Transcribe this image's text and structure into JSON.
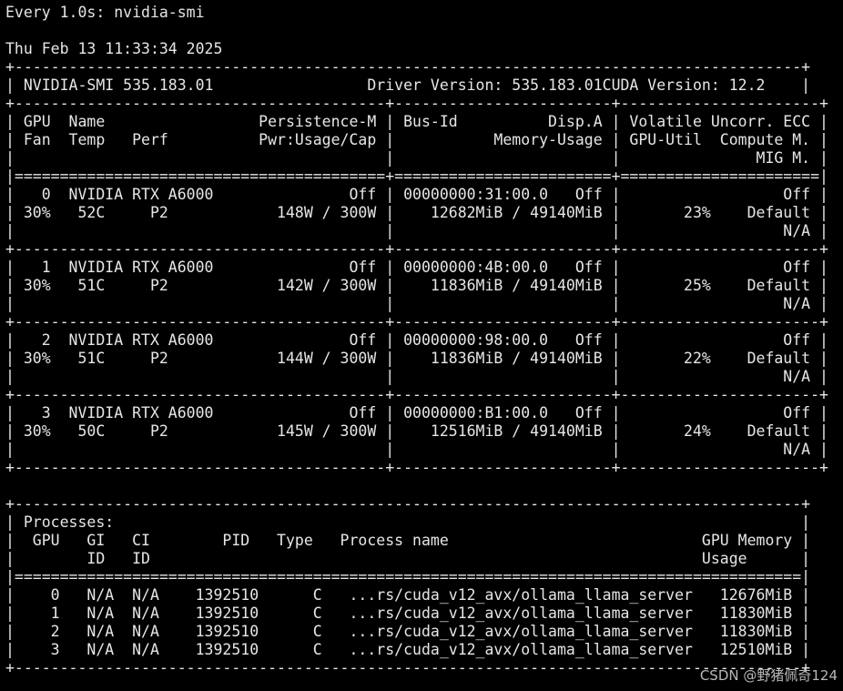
{
  "terminal": {
    "watch_header": "Every 1.0s: nvidia-smi",
    "timestamp": "Thu Feb 13 11:33:34 2025",
    "smi_version": "NVIDIA-SMI 535.183.01",
    "driver_version": "Driver Version: 535.183.01",
    "cuda_version": "CUDA Version: 12.2",
    "gpu_table": {
      "headers": {
        "col1": [
          "GPU  Name",
          "Fan  Temp   Perf",
          ""
        ],
        "col1_right": [
          "Persistence-M",
          "Pwr:Usage/Cap",
          ""
        ],
        "col2_left": [
          "Bus-Id",
          "",
          ""
        ],
        "col2_right": [
          "Disp.A",
          "Memory-Usage",
          ""
        ],
        "col3_left": [
          "Volatile",
          "GPU-Util",
          ""
        ],
        "col3_right": [
          "Uncorr. ECC",
          "Compute M.",
          "MIG M."
        ]
      },
      "gpus": [
        {
          "index": "0",
          "name": "NVIDIA RTX A6000",
          "persistence": "Off",
          "bus_id": "00000000:31:00.0",
          "disp": "Off",
          "ecc": "Off",
          "fan": "30%",
          "temp": "52C",
          "perf": "P2",
          "power": "148W / 300W",
          "memory": "12682MiB / 49140MiB",
          "util": "23%",
          "compute": "Default",
          "mig": "N/A"
        },
        {
          "index": "1",
          "name": "NVIDIA RTX A6000",
          "persistence": "Off",
          "bus_id": "00000000:4B:00.0",
          "disp": "Off",
          "ecc": "Off",
          "fan": "30%",
          "temp": "51C",
          "perf": "P2",
          "power": "142W / 300W",
          "memory": "11836MiB / 49140MiB",
          "util": "25%",
          "compute": "Default",
          "mig": "N/A"
        },
        {
          "index": "2",
          "name": "NVIDIA RTX A6000",
          "persistence": "Off",
          "bus_id": "00000000:98:00.0",
          "disp": "Off",
          "ecc": "Off",
          "fan": "30%",
          "temp": "51C",
          "perf": "P2",
          "power": "144W / 300W",
          "memory": "11836MiB / 49140MiB",
          "util": "22%",
          "compute": "Default",
          "mig": "N/A"
        },
        {
          "index": "3",
          "name": "NVIDIA RTX A6000",
          "persistence": "Off",
          "bus_id": "00000000:B1:00.0",
          "disp": "Off",
          "ecc": "Off",
          "fan": "30%",
          "temp": "50C",
          "perf": "P2",
          "power": "145W / 300W",
          "memory": "12516MiB / 49140MiB",
          "util": "24%",
          "compute": "Default",
          "mig": "N/A"
        }
      ]
    },
    "process_table": {
      "title": "Processes:",
      "headers": {
        "gpu": "GPU",
        "gi": [
          "GI",
          "ID"
        ],
        "ci": [
          "CI",
          "ID"
        ],
        "pid": "PID",
        "type": "Type",
        "name": "Process name",
        "mem": [
          "GPU Memory",
          "Usage"
        ]
      },
      "rows": [
        {
          "gpu": "0",
          "gi": "N/A",
          "ci": "N/A",
          "pid": "1392510",
          "type": "C",
          "name": "...rs/cuda_v12_avx/ollama_llama_server",
          "mem": "12676MiB"
        },
        {
          "gpu": "1",
          "gi": "N/A",
          "ci": "N/A",
          "pid": "1392510",
          "type": "C",
          "name": "...rs/cuda_v12_avx/ollama_llama_server",
          "mem": "11830MiB"
        },
        {
          "gpu": "2",
          "gi": "N/A",
          "ci": "N/A",
          "pid": "1392510",
          "type": "C",
          "name": "...rs/cuda_v12_avx/ollama_llama_server",
          "mem": "11830MiB"
        },
        {
          "gpu": "3",
          "gi": "N/A",
          "ci": "N/A",
          "pid": "1392510",
          "type": "C",
          "name": "...rs/cuda_v12_avx/ollama_llama_server",
          "mem": "12510MiB"
        }
      ]
    }
  },
  "watermark": "CSDN @野猪佩奇124"
}
